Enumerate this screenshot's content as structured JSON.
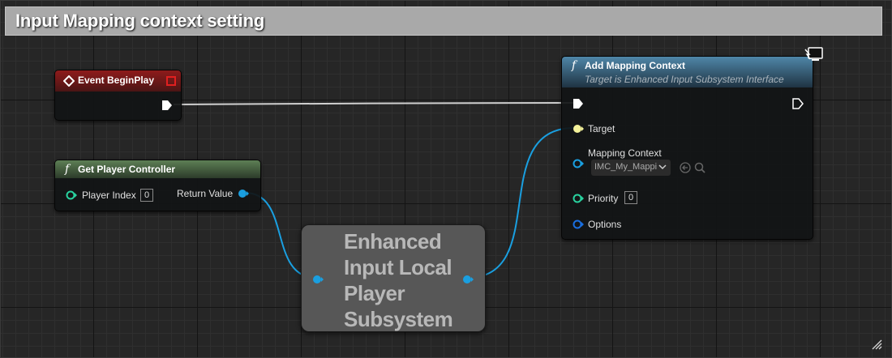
{
  "comment": {
    "title": "Input Mapping context setting"
  },
  "event_node": {
    "title": "Event BeginPlay"
  },
  "get_player_controller": {
    "title": "Get Player Controller",
    "inputs": [
      {
        "label": "Player Index",
        "value": "0"
      }
    ],
    "outputs": [
      {
        "label": "Return Value"
      }
    ]
  },
  "subsystem_node": {
    "title": "Enhanced Input Local Player Subsystem"
  },
  "add_mapping_context": {
    "title": "Add Mapping Context",
    "subtitle": "Target is Enhanced Input Subsystem Interface",
    "pins": {
      "target": "Target",
      "mapping_context": "Mapping Context",
      "mapping_context_value": "IMC_My_Mappi",
      "priority": "Priority",
      "priority_value": "0",
      "options": "Options"
    }
  },
  "colors": {
    "event_header": "#8e1b1b",
    "pure_func_header": "#4e6e47",
    "func_header": "#4a7a9a",
    "exec_wire": "#ffffff",
    "object_pin": "#1a9fe0",
    "struct_pin": "#1aa7c7",
    "int_pin": "#29d29f",
    "self_pin": "#f4f29a"
  }
}
